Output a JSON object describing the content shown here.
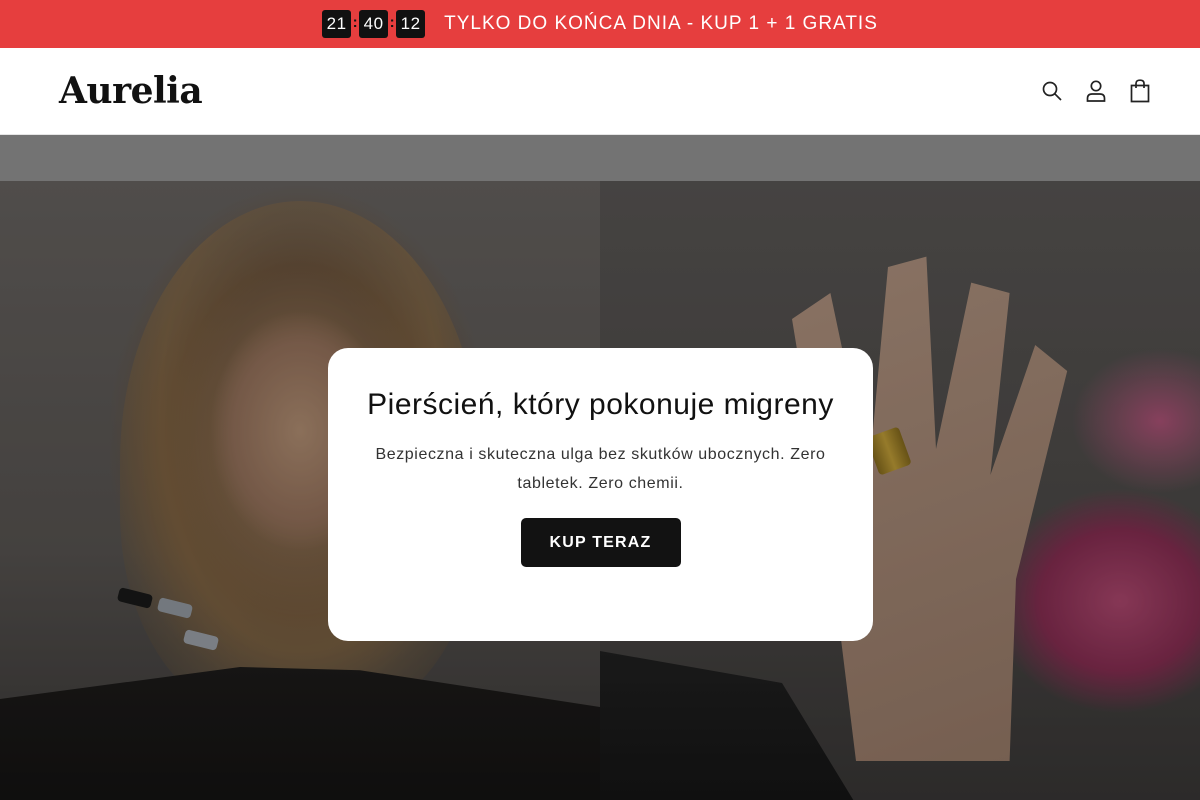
{
  "announcement": {
    "timer": {
      "hours": "21",
      "minutes": "40",
      "seconds": "12",
      "separator": ":"
    },
    "text": "TYLKO DO KOŃCA DNIA - KUP 1 + 1 GRATIS",
    "background_color": "#e63e3e"
  },
  "header": {
    "logo": "Aurelia",
    "icons": [
      "search-icon",
      "account-icon",
      "cart-icon"
    ]
  },
  "hero": {
    "title": "Pierścień, który pokonuje migreny",
    "subtitle": "Bezpieczna i skuteczna ulga bez skutków ubocznych. Zero tabletek. Zero chemii.",
    "cta_label": "KUP TERAZ"
  }
}
